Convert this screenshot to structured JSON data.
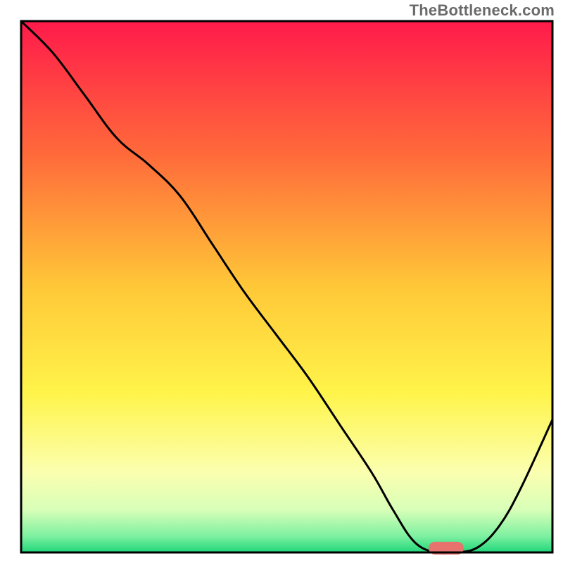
{
  "watermark": "TheBottleneck.com",
  "chart_data": {
    "type": "line",
    "title": "",
    "xlabel": "",
    "ylabel": "",
    "xlim": [
      0,
      100
    ],
    "ylim": [
      0,
      100
    ],
    "gradient_stops": [
      {
        "offset": 0,
        "color": "#ff1a4b"
      },
      {
        "offset": 25,
        "color": "#ff6a3a"
      },
      {
        "offset": 50,
        "color": "#ffc838"
      },
      {
        "offset": 70,
        "color": "#fff44a"
      },
      {
        "offset": 85,
        "color": "#fbffb0"
      },
      {
        "offset": 92,
        "color": "#d8ffb8"
      },
      {
        "offset": 97,
        "color": "#7cf0a0"
      },
      {
        "offset": 100,
        "color": "#1fd67a"
      }
    ],
    "curve": {
      "x": [
        0,
        6,
        12,
        18,
        24,
        30,
        36,
        42,
        48,
        54,
        60,
        66,
        70,
        74,
        78,
        82,
        86,
        90,
        94,
        100
      ],
      "y": [
        100,
        94,
        86,
        78,
        73,
        67,
        58,
        49,
        41,
        33,
        24,
        15,
        8,
        2,
        0,
        0,
        1,
        5,
        12,
        25
      ]
    },
    "marker": {
      "x_center": 80,
      "x_halfwidth": 3.3,
      "y": 0.8,
      "thickness": 2.4,
      "color": "#e8726e"
    },
    "frame_color": "#000000",
    "frame_width": 3
  }
}
